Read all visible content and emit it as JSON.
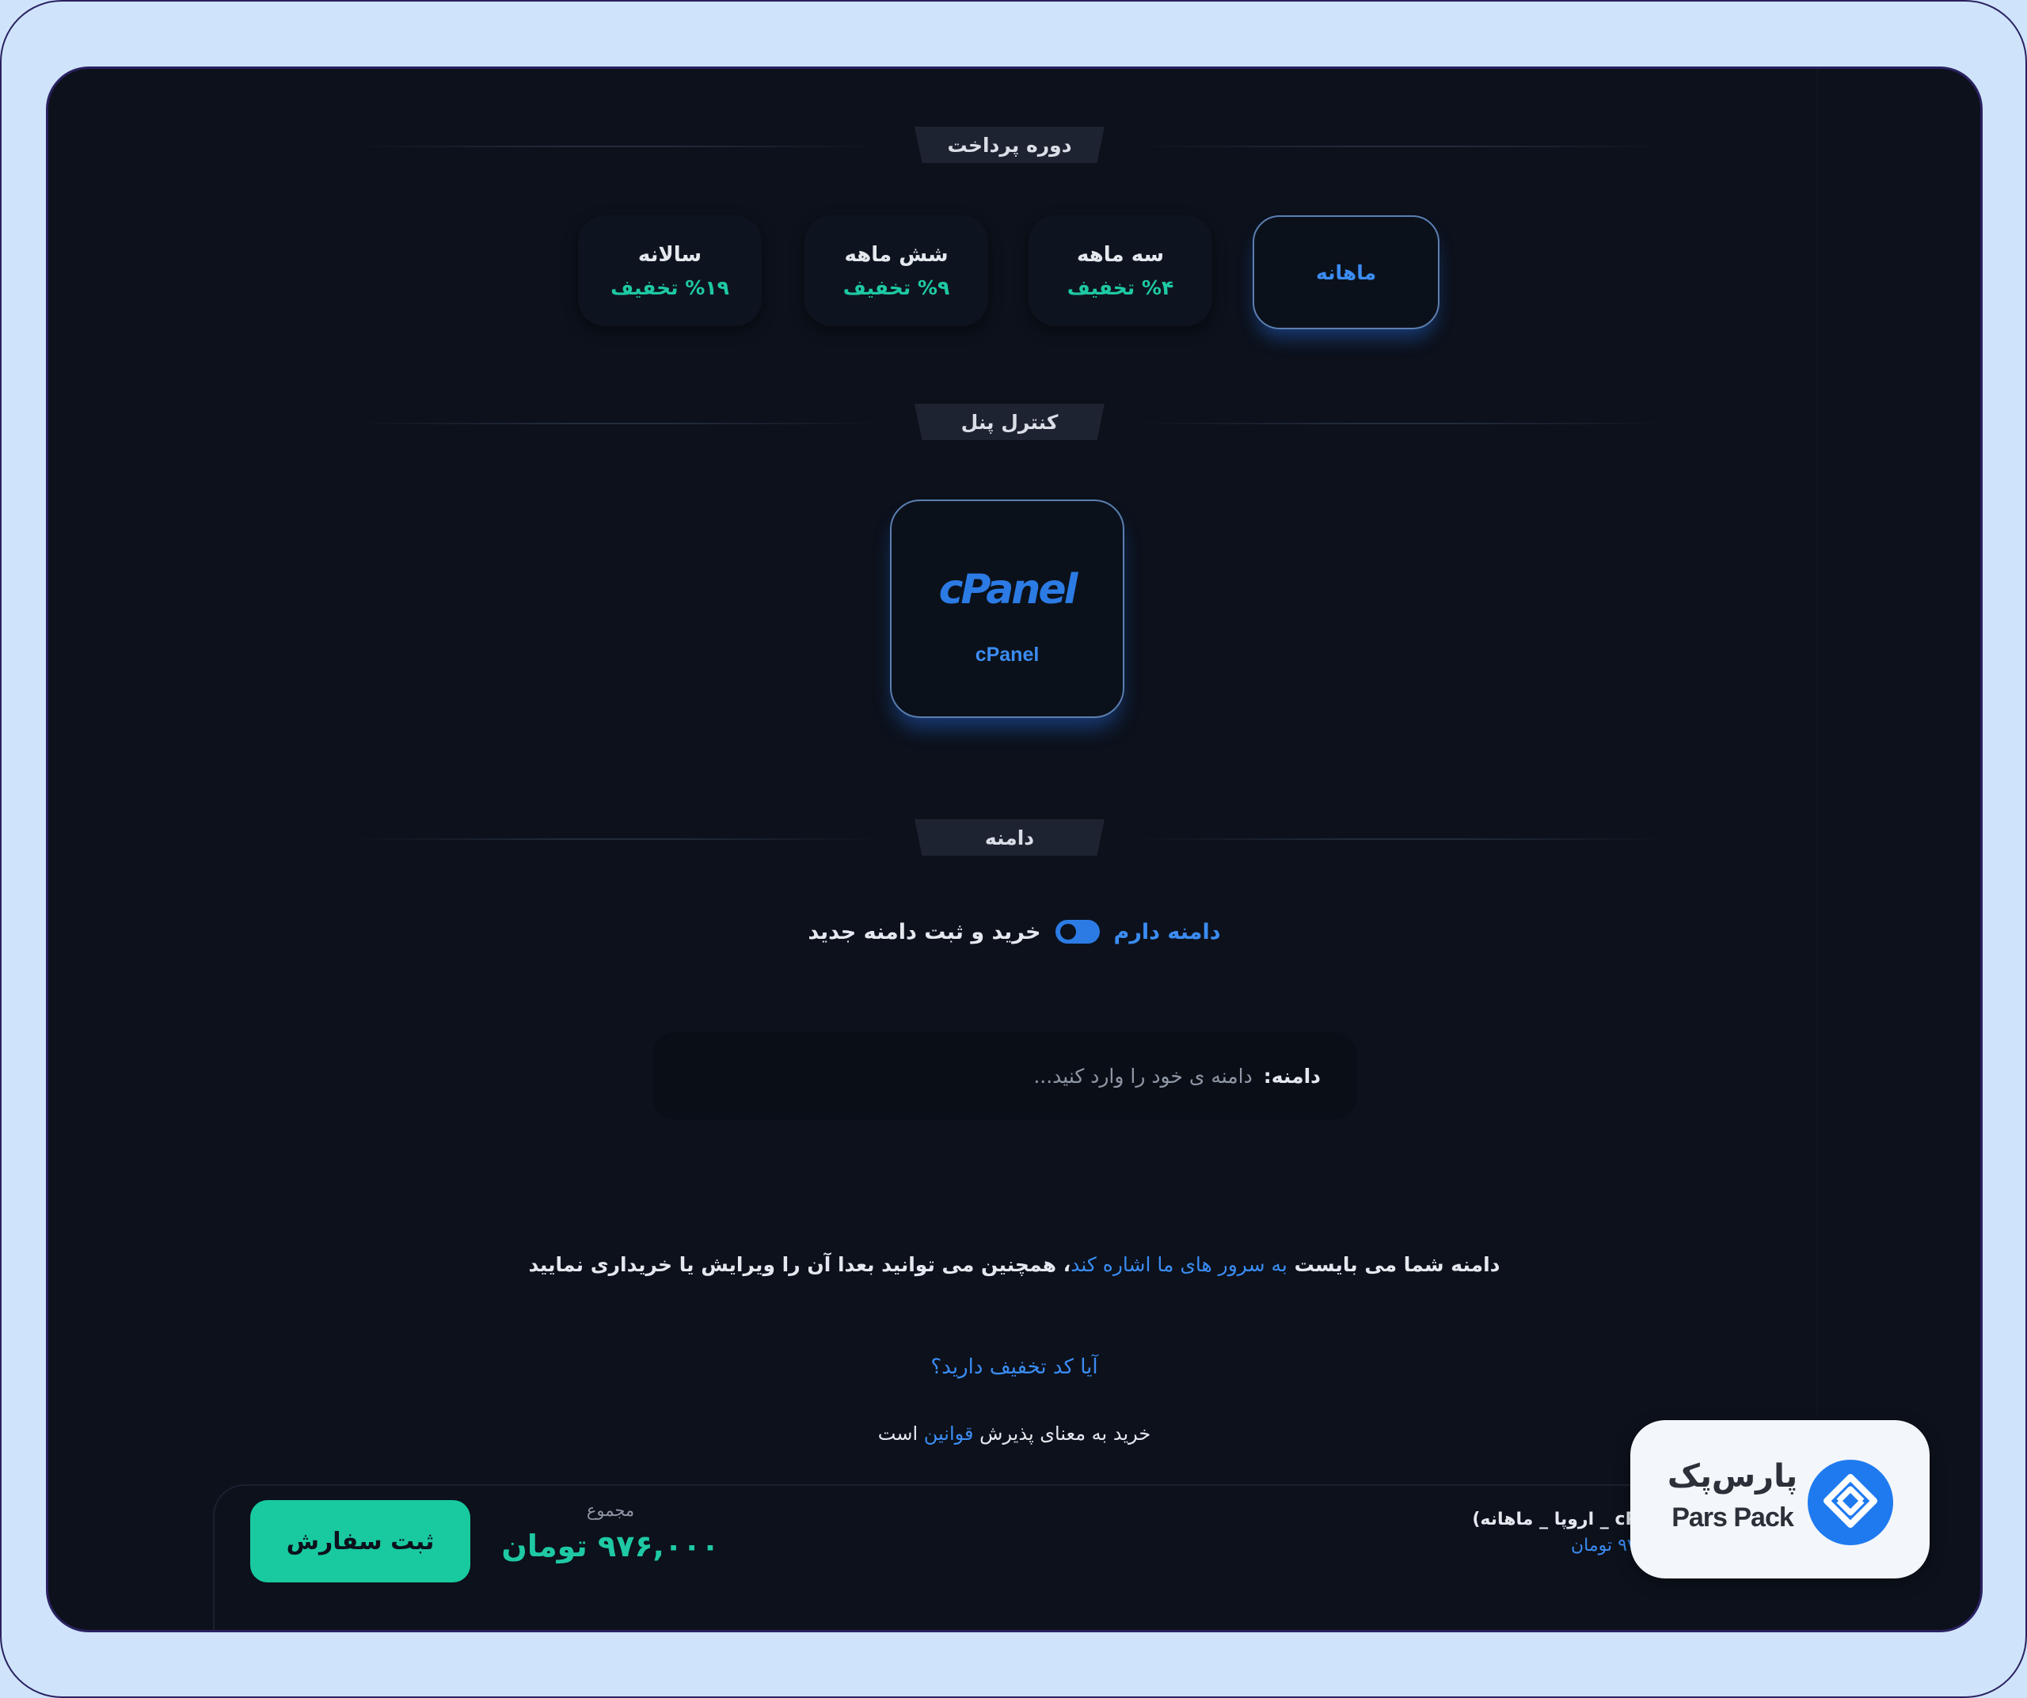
{
  "sections": {
    "payment_period": "دوره پرداخت",
    "control_panel": "کنترل پنل",
    "domain": "دامنه"
  },
  "periods": [
    {
      "label": "ماهانه",
      "discount": "",
      "selected": true
    },
    {
      "label": "سه ماهه",
      "discount": "%۴ تخفیف",
      "selected": false
    },
    {
      "label": "شش ماهه",
      "discount": "%۹ تخفیف",
      "selected": false
    },
    {
      "label": "سالانه",
      "discount": "%۱۹ تخفیف",
      "selected": false
    }
  ],
  "control_panel": {
    "logo_text": "cPanel",
    "name": "cPanel",
    "selected": true
  },
  "domain_options": {
    "own": "دامنه دارم",
    "new": "خرید و ثبت دامنه جدید",
    "toggle_on": true
  },
  "domain_input": {
    "label": "دامنه:",
    "placeholder": "دامنه ی خود را وارد کنید..."
  },
  "note": {
    "part1": "دامنه شما می بایست ",
    "link": "به سرور های ما اشاره کند",
    "part2": "، همچنین می توانید بعدا آن را ویرایش یا خریداری نمایید"
  },
  "coupon_link": "آیا کد تخفیف دارید؟",
  "terms": {
    "part1": "خرید به معنای پذیرش ",
    "link": "قوانین",
    "part2": " است"
  },
  "footer": {
    "order_button": "ثبت سفارش",
    "total_label": "مجموع",
    "total_value": "۹۷۶,۰۰۰ تومان",
    "summary_line": "cPanel _ اروپا _ ماهانه)",
    "summary_price": "۹۷۶,۰۰۰ تومان"
  },
  "brand": {
    "name_fa": "پارس‌پک",
    "name_en": "Pars Pack"
  },
  "colors": {
    "accent_blue": "#3b8cf2",
    "accent_green": "#1ec9a4",
    "background": "#0c111b",
    "frame": "#cfe4fb"
  }
}
